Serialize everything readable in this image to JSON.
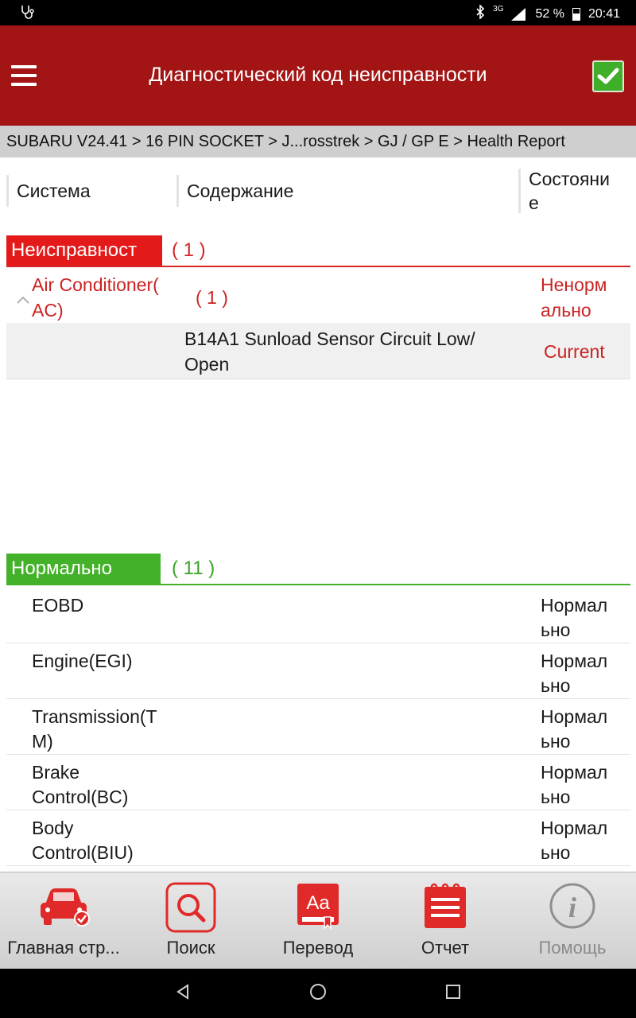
{
  "status_bar": {
    "network": "3G",
    "battery": "52 %",
    "battery_level": 0.52,
    "time": "20:41"
  },
  "app_bar": {
    "title": "Диагностический код неисправности"
  },
  "breadcrumb": "SUBARU V24.41 > 16 PIN SOCKET > J...rosstrek > GJ / GP E > Health Report",
  "table_header": {
    "system": "Система",
    "content": "Содержание",
    "state_line1": "Состояни",
    "state_line2": "е"
  },
  "fault_section": {
    "label": "Неисправност",
    "count": "( 1 )",
    "color": "#e41a1a",
    "systems": [
      {
        "name_line1": "Air Conditioner(",
        "name_line2": "AC)",
        "count": "( 1 )",
        "state_line1": "Ненорм",
        "state_line2": "ально",
        "codes": [
          {
            "text_line1": "B14A1 Sunload Sensor Circuit Low/",
            "text_line2": "Open",
            "status": "Current"
          }
        ]
      }
    ]
  },
  "normal_section": {
    "label": "Нормально",
    "count": "( 11 )",
    "color": "#44b12b",
    "rows": [
      {
        "name_line1": "EOBD",
        "name_line2": "",
        "state_line1": "Нормал",
        "state_line2": "ьно"
      },
      {
        "name_line1": "Engine(EGI)",
        "name_line2": "",
        "state_line1": "Нормал",
        "state_line2": "ьно"
      },
      {
        "name_line1": "Transmission(T",
        "name_line2": "M)",
        "state_line1": "Нормал",
        "state_line2": "ьно"
      },
      {
        "name_line1": "Brake",
        "name_line2": "Control(BC)",
        "state_line1": "Нормал",
        "state_line2": "ьно"
      },
      {
        "name_line1": "Body",
        "name_line2": "Control(BIU)",
        "state_line1": "Нормал",
        "state_line2": "ьно"
      }
    ]
  },
  "bottom_nav": {
    "home": "Главная стр...",
    "search": "Поиск",
    "translate": "Перевод",
    "report": "Отчет",
    "help": "Помощь",
    "accent": "#e02a2a"
  }
}
